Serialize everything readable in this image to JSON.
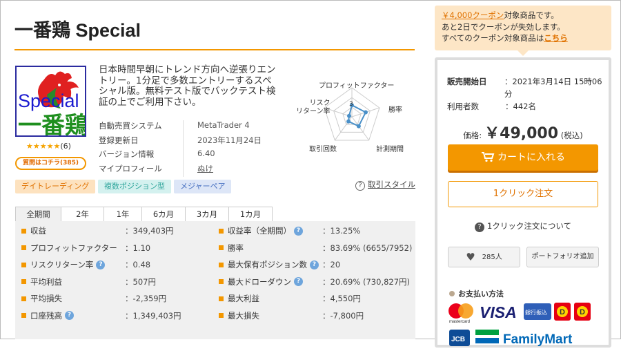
{
  "product": {
    "title": "一番鶏 Special",
    "logo_text_top": "Special",
    "logo_text_bottom": "一番鶏",
    "stars": "★★★★★",
    "review_count": "(6)",
    "question_button": "質問はコチラ(385)",
    "description": "日本時間早朝にトレンド方向へ逆張りエントリー。1分足で多数エントリーするスペシャル版。無料テスト版でバックテスト検証の上でご利用下さい。"
  },
  "info": [
    {
      "key": "自動売買システム",
      "value": "MetaTrader 4"
    },
    {
      "key": "登録更新日",
      "value": "2023年11月24日"
    },
    {
      "key": "バージョン情報",
      "value": "6.40"
    },
    {
      "key": "マイプロフィール",
      "value": "ぬけ"
    }
  ],
  "radar": {
    "labels": [
      "プロフィットファクター",
      "勝率",
      "計測期間",
      "取引回数",
      "リスク\nリターン率"
    ],
    "center_label": "3",
    "values": [
      2.0,
      2.5,
      2.0,
      1.0,
      0.5
    ],
    "max": 5,
    "color": "#4a90c8"
  },
  "tags": [
    "デイトレーディング",
    "複数ポジション型",
    "メジャーペア"
  ],
  "trade_style_link": "取引スタイル",
  "tabs": [
    "全期間",
    "2年",
    "1年",
    "6カ月",
    "3カ月",
    "1カ月"
  ],
  "stats_left": [
    {
      "key": "収益",
      "value": "：349,403円",
      "help": false
    },
    {
      "key": "プロフィットファクター",
      "value": "：1.10",
      "help": false
    },
    {
      "key": "リスクリターン率",
      "value": "：0.48",
      "help": true
    },
    {
      "key": "平均利益",
      "value": "：507円",
      "help": false
    },
    {
      "key": "平均損失",
      "value": "：-2,359円",
      "help": false
    },
    {
      "key": "口座残高",
      "value": "：1,349,403円",
      "help": true
    }
  ],
  "stats_right": [
    {
      "key": "収益率（全期間）",
      "value": "：13.25%",
      "help": true
    },
    {
      "key": "勝率",
      "value": "：83.69% (6655/7952)",
      "help": false
    },
    {
      "key": "最大保有ポジション数",
      "value": "：20",
      "help": true
    },
    {
      "key": "最大ドローダウン",
      "value": "：20.69% (730,827円)",
      "help": true
    },
    {
      "key": "最大利益",
      "value": "：4,550円",
      "help": false
    },
    {
      "key": "最大損失",
      "value": "：-7,800円",
      "help": false
    }
  ],
  "coupon": {
    "link": "￥4,000クーポン",
    "line1_rest": "対象商品です。",
    "line2": "あと2日でクーポンが失効します。",
    "line3": "すべてのクーポン対象商品は",
    "line3_link": "こちら"
  },
  "sale": [
    {
      "key": "販売開始日",
      "value": "：2021年3月14日 15時06分"
    },
    {
      "key": "利用者数",
      "value": "：442名"
    }
  ],
  "price": {
    "label": "価格:",
    "value": "￥49,000",
    "tax": "(税込)"
  },
  "buttons": {
    "cart": "カートに入れる",
    "oneclick": "1クリック注文",
    "about_oneclick": "1クリック注文について",
    "likes": "285人",
    "portfolio": "ポートフォリオ追加"
  },
  "payment": {
    "title": "お支払い方法",
    "visa": "VISA",
    "mastercard": "mastercard",
    "bank": "銀行振込",
    "familymart": "FamilyMart",
    "jcb": "JCB"
  }
}
